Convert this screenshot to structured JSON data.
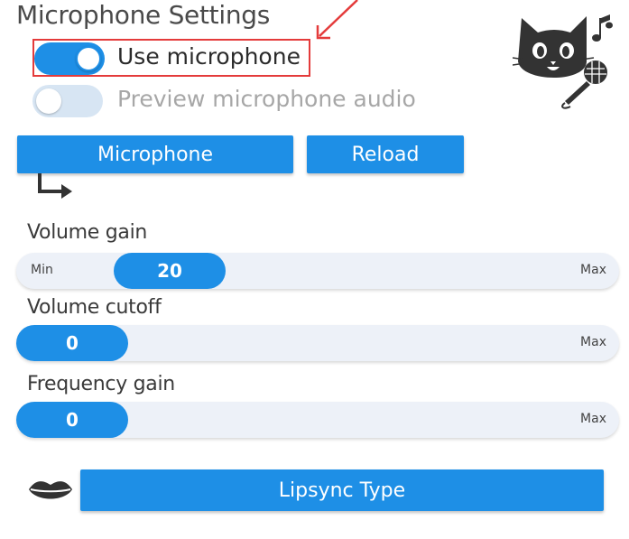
{
  "window": {
    "title": "Microphone Settings"
  },
  "toggles": [
    {
      "label": "Use microphone",
      "state": "on"
    },
    {
      "label": "Preview microphone audio",
      "state": "off"
    }
  ],
  "buttons": {
    "microphone": "Microphone",
    "reload": "Reload",
    "lipsync": "Lipsync Type"
  },
  "sliders": [
    {
      "label": "Volume gain",
      "value": "20",
      "min_label": "Min",
      "max_label": "Max"
    },
    {
      "label": "Volume cutoff",
      "value": "0",
      "max_label": "Max"
    },
    {
      "label": "Frequency gain",
      "value": "0",
      "max_label": "Max"
    }
  ],
  "icons": [
    "cat-microphone-icon",
    "lips-icon",
    "corner-arrow-icon",
    "red-annotation-arrow"
  ],
  "colors": {
    "accent": "#1e8fe6",
    "track": "#edf1f8",
    "annotation": "#e43b3b"
  }
}
